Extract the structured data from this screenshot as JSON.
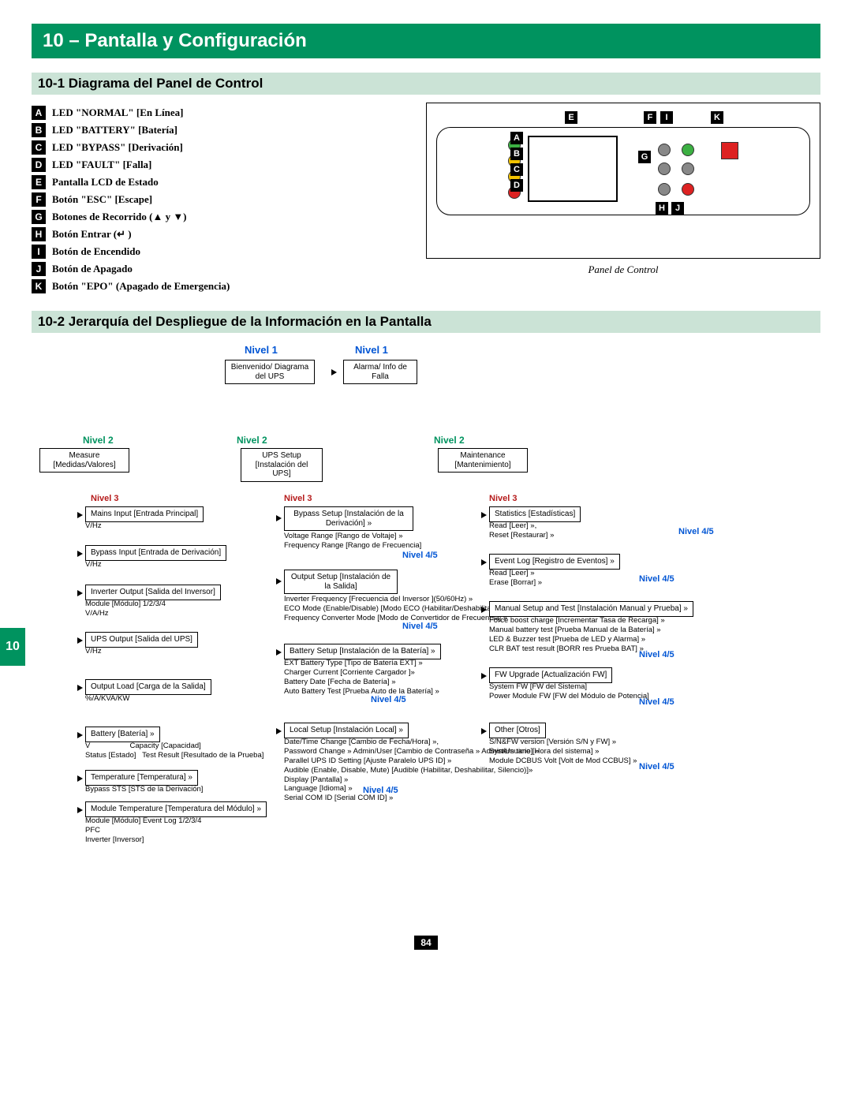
{
  "title": "10 – Pantalla y Configuración",
  "section1": "10-1 Diagrama del Panel de Control",
  "legend": {
    "A": "LED \"NORMAL\" [En Línea]",
    "B": "LED \"BATTERY\" [Batería]",
    "C": "LED \"BYPASS\" [Derivación]",
    "D": "LED \"FAULT\" [Falla]",
    "E": "Pantalla LCD de Estado",
    "F": "Botón \"ESC\" [Escape]",
    "G": "Botones de Recorrido (▲ y ▼)",
    "H": "Botón Entrar (↵ )",
    "I": "Botón de Encendido",
    "J": "Botón de Apagado",
    "K": "Botón \"EPO\" (Apagado de Emergencia)"
  },
  "panel_caption": "Panel de Control",
  "section2": "10-2 Jerarquía del Despliegue de la Información en la Pantalla",
  "levels": {
    "n1a": "Nivel 1",
    "n1b": "Nivel 1",
    "l2": "Nivel 2",
    "l3": "Nivel 3",
    "l45": "Nivel 4/5"
  },
  "boxes": {
    "welcome": "Bienvenido/\nDiagrama del UPS",
    "alarm": "Alarma/\nInfo de Falla",
    "measure": "Measure\n[Medidas/Valores]",
    "setup": "UPS Setup\n[Instalación\ndel UPS]",
    "maint": "Maintenance\n[Mantenimiento]",
    "mains": "Mains Input [Entrada Principal]",
    "bypassin": "Bypass Input [Entrada de Derivación]",
    "invout": "Inverter Output [Salida del Inversor]",
    "upsout": "UPS Output [Salida del UPS]",
    "outload": "Output Load [Carga de la Salida]",
    "battery": "Battery [Batería] »",
    "temp": "Temperature [Temperatura] »",
    "modtemp": "Module Temperature [Temperatura del Módulo] »",
    "bypasssetup": "Bypass Setup\n[Instalación de la Derivación] »",
    "outputsetup": "Output Setup\n[Instalación de la Salida]",
    "batterysetup": "Battery Setup [Instalación de la Batería] »",
    "localsetup": "Local Setup [Instalación Local] »",
    "stats": "Statistics [Estadísticas]",
    "eventlog": "Event Log [Registro de Eventos] »",
    "manual": "Manual Setup and Test [Instalación Manual y Prueba] »",
    "fwupg": "FW Upgrade [Actualización FW]",
    "other": "Other [Otros]"
  },
  "notes": {
    "vhz": "V/Hz",
    "module": "Module [Módulo] 1/2/3/4",
    "vahz": "V/A/Hz",
    "pct": "%/A/KVA/KW",
    "batdet": "V                   Capacity [Capacidad]\nStatus [Estado]   Test Result [Resultado de la Prueba]",
    "bypasssts": "Bypass STS [STS de la Derivación]",
    "modtempdet": "Module [Módulo] Event Log 1/2/3/4\nPFC\nInverter [Inversor]",
    "bypasssetupdet": "Voltage Range [Rango de Voltaje] »\nFrequency Range [Rango de Frecuencia]",
    "outputsetupdet": "Inverter Frequency [Frecuencia del Inversor ](50/60Hz) »\nECO Mode (Enable/Disable) [Modo ECO (Habilitar/Deshabilitar)] »\nFrequency Converter Mode [Modo de Convertidor de Frecuencia] »",
    "batterysetupdet": "EXT Battery Type [Tipo de Batería EXT] »\nCharger Current [Corriente Cargador ]»\nBattery Date [Fecha de Batería] »\nAuto Battery Test [Prueba Auto de la Batería] »",
    "localsetupdet": "Date/Time Change [Cambio de Fecha/Hora] »,\nPassword Change » Admin/User [Cambio de Contraseña » Admin/Usuario] »\nParallel UPS ID Setting [Ajuste Paralelo UPS ID] »\nAudible (Enable, Disable, Mute) [Audible (Habilitar, Deshabilitar, Silencio)]»\nDisplay [Pantalla] »\nLanguage [Idioma] »\nSerial COM ID [Serial COM ID] »",
    "statsdet": "Read [Leer] »,\nReset [Restaurar] »",
    "eventlogdet": "Read [Leer] »\nErase [Borrar] »",
    "manualdet": "Force boost charge [Incrementar Tasa de Recarga] »\nManual battery test [Prueba Manual de la Batería] »\nLED & Buzzer test [Prueba de LED y Alarma] »\nCLR BAT test result [BORR res Prueba BAT] »",
    "fwupgdet": "System FW [FW del Sistema]\nPower Module FW [FW del Módulo de Potencia]",
    "otherdet": "S/N&FW version [Versión S/N y FW] »\nSystem time [Hora del sistema] »\nModule DCBUS Volt [Volt de Mod CCBUS] »"
  },
  "side_tab": "10",
  "page_number": "84"
}
